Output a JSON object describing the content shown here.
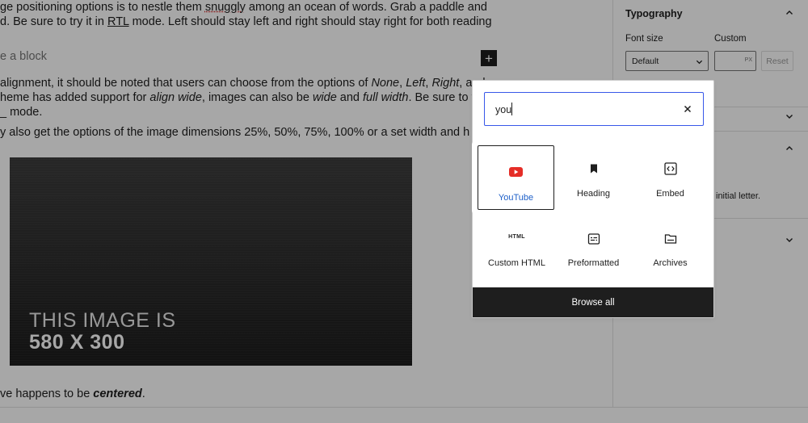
{
  "editor": {
    "paragraph1": {
      "line1_a": "ge positioning options is to nestle them ",
      "line1_word": "snuggly",
      "line1_b": " among an ocean of words. Grab a paddle and",
      "line2_a": "d. Be sure to try it in ",
      "line2_word": "RTL",
      "line2_b": " mode. Left should stay left and right should stay right for both reading"
    },
    "placeholder": "e a block",
    "inserter_symbol": "+",
    "paragraph2": {
      "line1_a": "alignment, it should be noted that users can choose from the options of ",
      "opt1": "None",
      "sep1": ", ",
      "opt2": "Left",
      "sep2": ", ",
      "opt3": "Right",
      "sep3": ", and",
      "line2_a": "heme has added support for ",
      "opt4": "align wide",
      "line2_b": ", images can also be ",
      "opt5": "wide",
      "line2_c": " and ",
      "opt6": "full width",
      "line2_d": ". Be sure to t",
      "line3": "_ mode."
    },
    "paragraph3": "y also get the options of the image dimensions 25%, 50%, 75%, 100% or a set width and h",
    "image": {
      "line1": "THIS IMAGE IS",
      "line2": "580 X 300"
    },
    "bottom_a": "ve happens to be ",
    "bottom_b": "centered",
    "bottom_c": "."
  },
  "sidebar": {
    "typography_title": "Typography",
    "font_size_label": "Font size",
    "custom_label": "Custom",
    "font_size_value": "Default",
    "unit": "PX",
    "reset_label": "Reset",
    "partial_note": "initial letter."
  },
  "inserter": {
    "search_value": "you",
    "blocks": [
      {
        "name": "YouTube",
        "icon": "youtube-icon"
      },
      {
        "name": "Heading",
        "icon": "bookmark-icon"
      },
      {
        "name": "Embed",
        "icon": "embed-icon"
      },
      {
        "name": "Custom HTML",
        "icon": "html-icon"
      },
      {
        "name": "Preformatted",
        "icon": "preformatted-icon"
      },
      {
        "name": "Archives",
        "icon": "folder-icon"
      }
    ],
    "html_icon_text": "HTML",
    "browse_all_label": "Browse all"
  },
  "colors": {
    "accent": "#3858e9",
    "youtube_red": "#e52d27",
    "link_blue": "#1e60c9",
    "dark": "#1e1e1e"
  }
}
